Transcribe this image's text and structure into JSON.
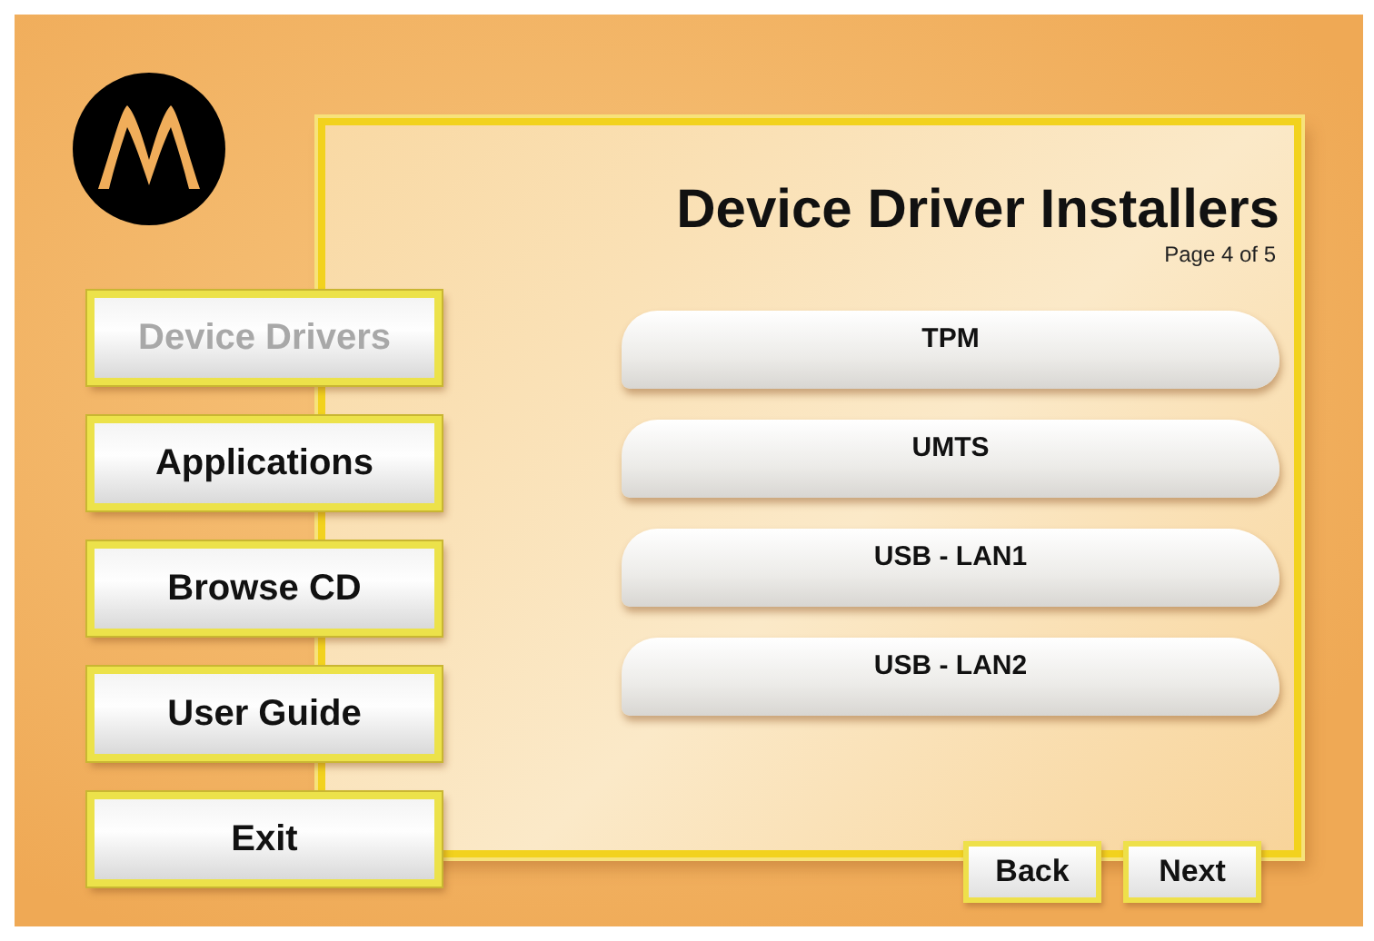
{
  "sidebar": {
    "items": [
      {
        "label": "Device Drivers",
        "disabled": true
      },
      {
        "label": "Applications",
        "disabled": false
      },
      {
        "label": "Browse CD",
        "disabled": false
      },
      {
        "label": "User Guide",
        "disabled": false
      },
      {
        "label": "Exit",
        "disabled": false
      }
    ]
  },
  "panel": {
    "title": "Device Driver Installers",
    "page": "Page 4 of 5",
    "installers": [
      "TPM",
      "UMTS",
      "USB - LAN1",
      "USB - LAN2"
    ],
    "buttons": [
      "Back",
      "Next"
    ]
  }
}
